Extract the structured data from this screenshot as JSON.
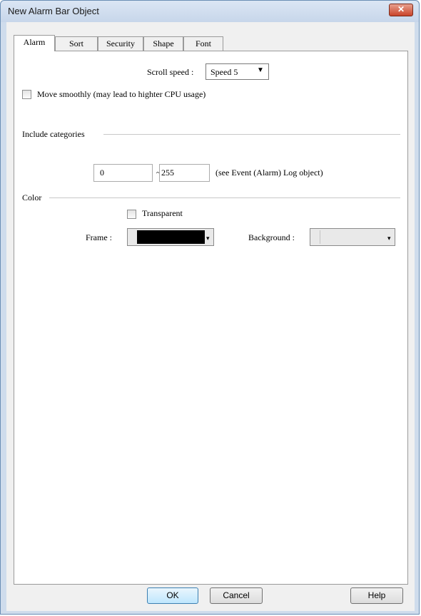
{
  "window": {
    "title": "New Alarm Bar Object"
  },
  "tabs": [
    "Alarm",
    "Sort",
    "Security",
    "Shape",
    "Font"
  ],
  "alarm": {
    "scroll_speed_label": "Scroll speed :",
    "scroll_speed_value": "Speed 5",
    "move_smoothly_label": "Move smoothly (may lead to highter CPU usage)",
    "include_categories_label": "Include categories",
    "category_from": "0",
    "category_separator": "~",
    "category_to": "255",
    "category_note": "(see Event (Alarm) Log object)",
    "color_label": "Color",
    "transparent_label": "Transparent",
    "frame_label": "Frame :",
    "frame_color": "#000000",
    "background_label": "Background :",
    "background_color": "#e9e9e9"
  },
  "buttons": {
    "ok": "OK",
    "cancel": "Cancel",
    "help": "Help"
  }
}
